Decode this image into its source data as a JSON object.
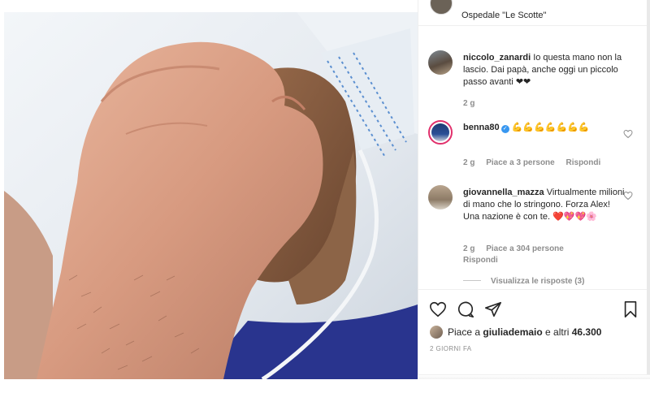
{
  "location": {
    "text": "Ospedale \"Le Scotte\""
  },
  "comments": [
    {
      "username": "niccolo_zanardi",
      "text": "Io questa mano non la lascio. Dai papà, anche oggi un piccolo passo avanti ❤❤",
      "age": "2 g",
      "likes": "",
      "reply_label": ""
    },
    {
      "username": "benna80",
      "verified": true,
      "text": "💪💪💪💪💪💪💪",
      "age": "2 g",
      "likes": "Piace a 3 persone",
      "reply_label": "Rispondi"
    },
    {
      "username": "giovannella_mazza",
      "text": "Virtualmente milioni di mano che lo stringono. Forza Alex! Una nazione è con te. ❤️💖💖🌸",
      "age": "2 g",
      "likes": "Piace a 304 persone",
      "reply_label": "Rispondi"
    }
  ],
  "view_replies": "Visualizza le risposte (3)",
  "actions": {
    "icons": [
      "heart-icon",
      "comment-icon",
      "share-icon",
      "bookmark-icon"
    ]
  },
  "likes": {
    "prefix": "Piace a ",
    "user": "giuliademaio",
    "middle": " e altri ",
    "count": "46.300"
  },
  "post_time": "2 GIORNI FA",
  "colors": {
    "verified": "#3897f0",
    "story_ring": "#e1306c",
    "meta_text": "#8e8e8e"
  }
}
